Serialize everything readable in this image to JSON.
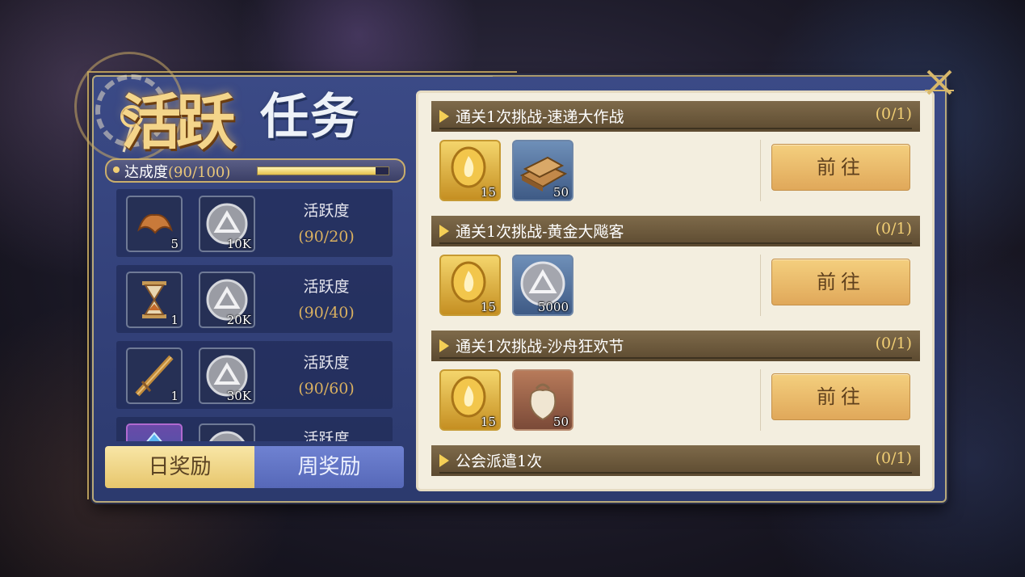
{
  "dialog": {
    "title_part1": "活跃",
    "title_part2": "任务"
  },
  "progress": {
    "label": "达成度",
    "value_text": "(90/100)",
    "fill_fraction": 0.9
  },
  "milestones": [
    {
      "item_icon": "croissant-icon",
      "item_count": "5",
      "coin_icon": "silver-coin-icon",
      "coin_count": "10K",
      "label": "活跃度",
      "value": "(90/20)"
    },
    {
      "item_icon": "hourglass-icon",
      "item_count": "1",
      "coin_icon": "silver-coin-icon",
      "coin_count": "20K",
      "label": "活跃度",
      "value": "(90/40)"
    },
    {
      "item_icon": "syringe-icon",
      "item_count": "1",
      "coin_icon": "silver-coin-icon",
      "coin_count": "30K",
      "label": "活跃度",
      "value": "(90/60)"
    },
    {
      "item_icon": "crystal-icon",
      "item_count": "",
      "coin_icon": "silver-coin-icon",
      "coin_count": "",
      "label": "活跃度",
      "value": ""
    }
  ],
  "tabs": {
    "daily": "日奖励",
    "weekly": "周奖励"
  },
  "tasks": [
    {
      "name": "通关1次挑战-速递大作战",
      "count": "(0/1)",
      "button": "前往",
      "rewards": [
        {
          "icon": "gold-flame-token-icon",
          "count": "15"
        },
        {
          "icon": "wood-plank-icon",
          "count": "50"
        }
      ]
    },
    {
      "name": "通关1次挑战-黄金大飚客",
      "count": "(0/1)",
      "button": "前往",
      "rewards": [
        {
          "icon": "gold-flame-token-icon",
          "count": "15"
        },
        {
          "icon": "silver-coin-icon",
          "count": "5000"
        }
      ]
    },
    {
      "name": "通关1次挑战-沙舟狂欢节",
      "count": "(0/1)",
      "button": "前往",
      "rewards": [
        {
          "icon": "gold-flame-token-icon",
          "count": "15"
        },
        {
          "icon": "cloth-sack-icon",
          "count": "50"
        }
      ]
    },
    {
      "name": "公会派遣1次",
      "count": "(0/1)"
    }
  ],
  "colors": {
    "accent_gold": "#f2cf74",
    "panel_blue": "#3b4a86",
    "button_orange": "#e0a85a"
  }
}
